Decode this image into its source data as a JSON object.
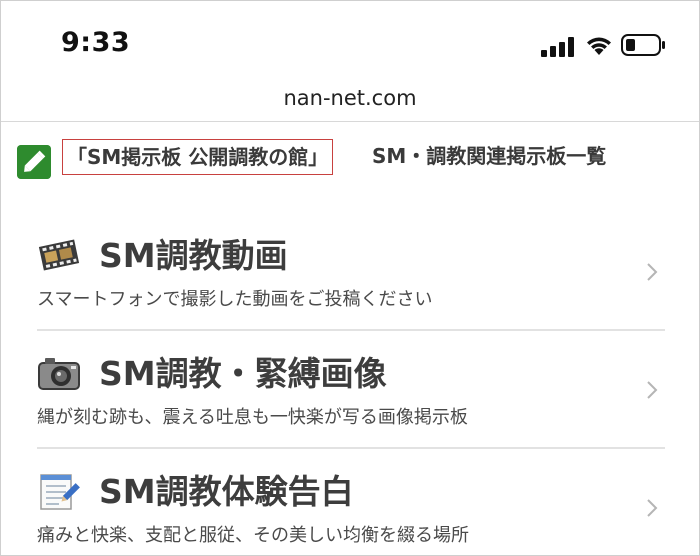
{
  "status_bar": {
    "time": "9:33"
  },
  "browser": {
    "url": "nan-net.com"
  },
  "header": {
    "boxed_title": "「SM掲示板 公開調教の館」",
    "subtitle": "SM・調教関連掲示板一覧",
    "icon": "pencil-icon"
  },
  "menu": {
    "items": [
      {
        "title": "SM調教動画",
        "description": "スマートフォンで撮影した動画をご投稿ください",
        "icon": "film-icon"
      },
      {
        "title": "SM調教・緊縛画像",
        "description": "縄が刻む跡も、震える吐息も一快楽が写る画像掲示板",
        "icon": "camera-icon"
      },
      {
        "title": "SM調教体験告白",
        "description": "痛みと快楽、支配と服従、その美しい均衡を綴る場所",
        "icon": "notepad-icon"
      }
    ]
  },
  "colors": {
    "accent_green": "#2e8b2e",
    "title_box_border": "#c8413f",
    "divider": "#e2e2e2"
  }
}
